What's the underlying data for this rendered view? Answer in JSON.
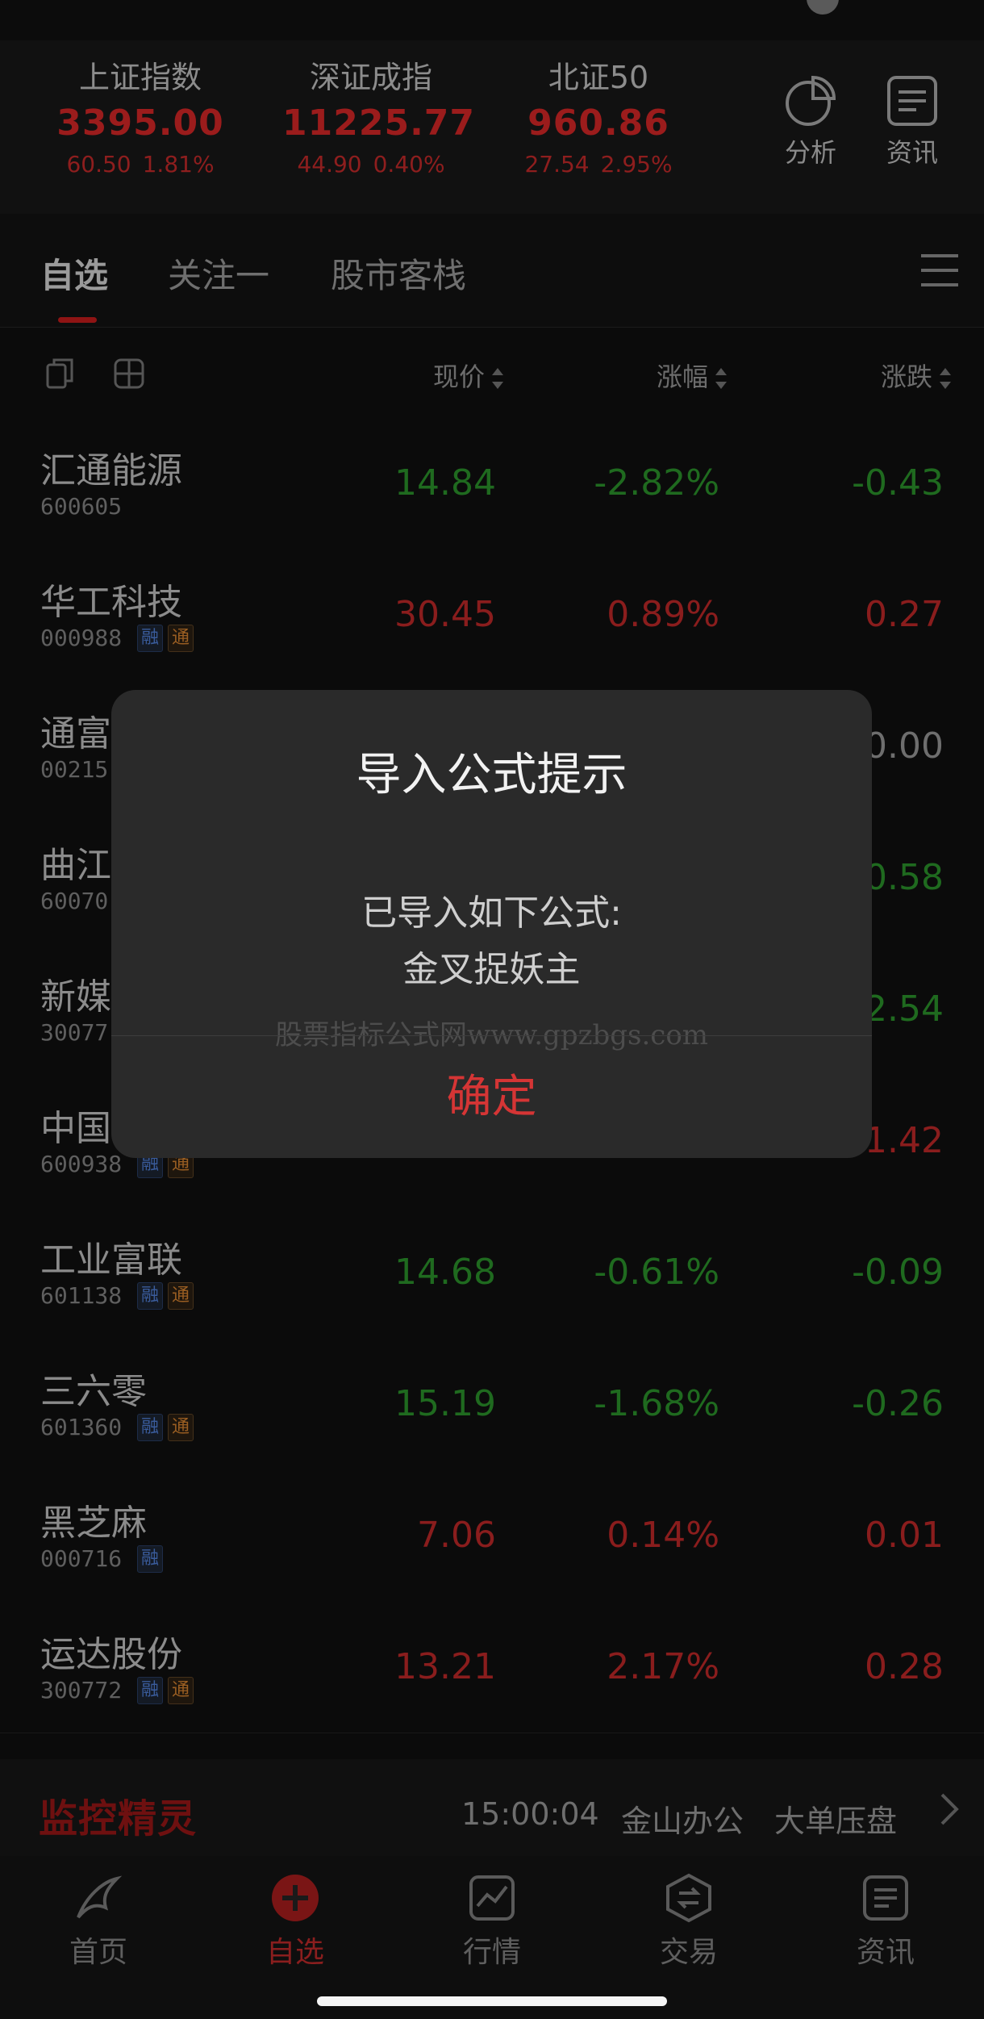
{
  "indices": [
    {
      "name": "上证指数",
      "value": "3395.00",
      "change": "60.50",
      "pct": "1.81%"
    },
    {
      "name": "深证成指",
      "value": "11225.77",
      "change": "44.90",
      "pct": "0.40%"
    },
    {
      "name": "北证50",
      "value": "960.86",
      "change": "27.54",
      "pct": "2.95%"
    }
  ],
  "quick": {
    "analysis": "分析",
    "news": "资讯"
  },
  "tabs": [
    "自选",
    "关注一",
    "股市客栈"
  ],
  "columns": {
    "price": "现价",
    "pct": "涨幅",
    "change": "涨跌"
  },
  "tags": {
    "rong": "融",
    "tong": "通"
  },
  "rows": [
    {
      "name": "汇通能源",
      "code": "600605",
      "price": "14.84",
      "pct": "-2.82%",
      "change": "-0.43"
    },
    {
      "name": "华工科技",
      "code": "000988",
      "price": "30.45",
      "pct": "0.89%",
      "change": "0.27"
    },
    {
      "name": "通富",
      "code": "00215",
      "price": "",
      "pct": "",
      "change": "0.00"
    },
    {
      "name": "曲江",
      "code": "60070",
      "price": "",
      "pct": "",
      "change": "0.58"
    },
    {
      "name": "新媒",
      "code": "30077",
      "price": "",
      "pct": "",
      "change": "2.54"
    },
    {
      "name": "中国",
      "code": "600938",
      "price": "",
      "pct": "",
      "change": "1.42"
    },
    {
      "name": "工业富联",
      "code": "601138",
      "price": "14.68",
      "pct": "-0.61%",
      "change": "-0.09"
    },
    {
      "name": "三六零",
      "code": "601360",
      "price": "15.19",
      "pct": "-1.68%",
      "change": "-0.26"
    },
    {
      "name": "黑芝麻",
      "code": "000716",
      "price": "7.06",
      "pct": "0.14%",
      "change": "0.01"
    },
    {
      "name": "运达股份",
      "code": "300772",
      "price": "13.21",
      "pct": "2.17%",
      "change": "0.28"
    }
  ],
  "monitor": {
    "logo": "监控精灵",
    "time": "15:00:04",
    "stock": "金山办公",
    "event": "大单压盘"
  },
  "nav": [
    "首页",
    "自选",
    "行情",
    "交易",
    "资讯"
  ],
  "dialog": {
    "title": "导入公式提示",
    "line1": "已导入如下公式:",
    "line2": "金叉捉妖主",
    "confirm": "确定",
    "watermark": "股票指标公式网www.gpzbgs.com"
  },
  "colors": {
    "up": "#8a1d1d",
    "down": "#1f6a1f",
    "accent": "#d53535"
  }
}
